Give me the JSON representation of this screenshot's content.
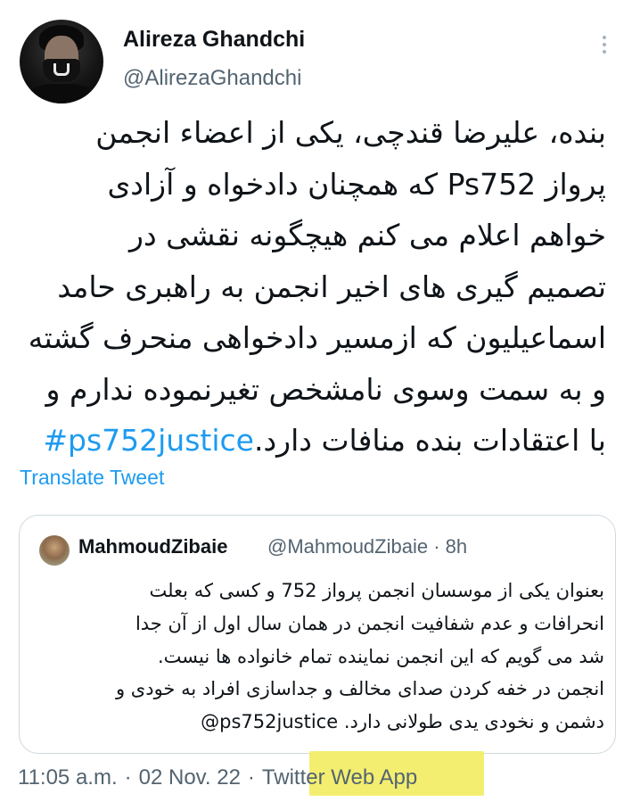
{
  "author": {
    "display_name": "Alireza Ghandchi",
    "handle": "@AlirezaGhandchi"
  },
  "tweet": {
    "lines": [
      "بنده، علیرضا قندچی، یکی از اعضاء انجمن",
      "پرواز Ps752 که همچنان دادخواه و آزادی",
      "خواهم اعلام می کنم هیچگونه نقشی در",
      "تصمیم گیری های اخیر انجمن به راهبری حامد",
      "اسماعیلیون که ازمسیر دادخواهی منحرف گشته",
      "و به سمت وسوی نامشخص تغیرنموده ندارم و"
    ],
    "last_line_text": "با اعتقادات بنده منافات دارد.",
    "hashtag": "#ps752justice"
  },
  "translate_label": "Translate Tweet",
  "quote": {
    "display_name": "MahmoudZibaie",
    "handle": "@MahmoudZibaie",
    "separator": "·",
    "time": "8h",
    "lines": [
      "بعنوان یکی از موسسان انجمن پرواز 752 و کسی که بعلت",
      "انحرافات و عدم شفافیت انجمن در همان سال اول از آن جدا",
      "شد می گویم که این انجمن نماینده تمام خانواده ها نیست.",
      "انجمن در خفه کردن صدای مخالف و جداسازی افراد به خودی و"
    ],
    "last_line_text": "دشمن و نخودی یدی طولانی دارد.",
    "mention": "@ps752justice"
  },
  "footer": {
    "time": "11:05 a.m.",
    "sep1": "·",
    "date": "02 Nov. 22",
    "sep2": "·",
    "source": "Twitter Web App"
  },
  "colors": {
    "accent": "#1d9bf0",
    "text": "#0f1419",
    "secondary": "#536471",
    "border": "#cfd9de",
    "highlight": "#f3ee6f"
  },
  "icons": {
    "more": "more-vertical-icon"
  }
}
